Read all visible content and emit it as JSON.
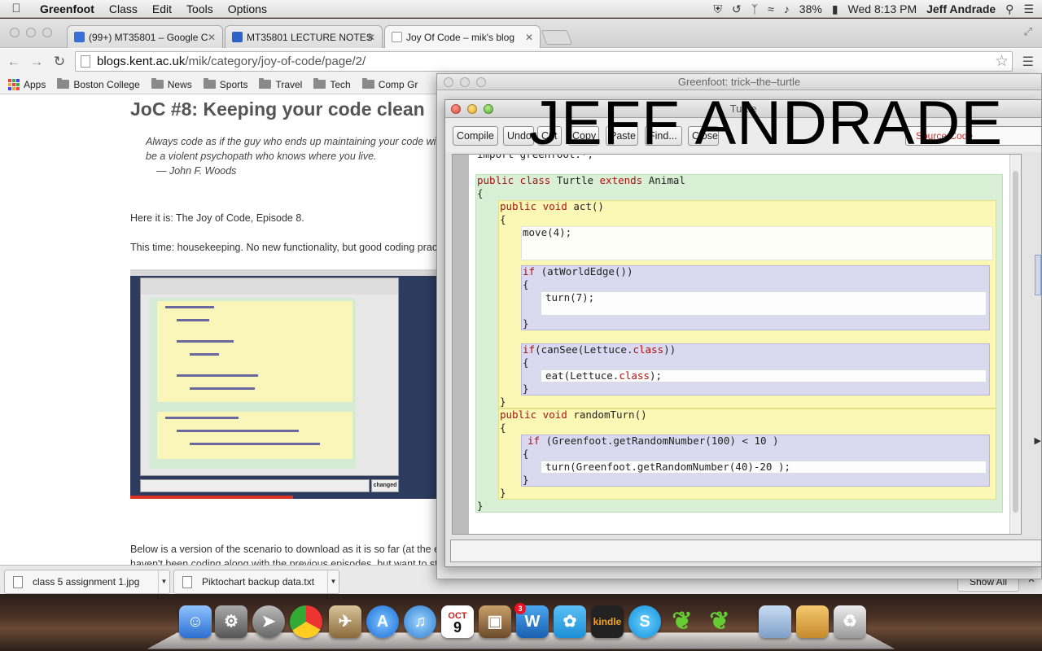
{
  "menubar": {
    "app_name": "Greenfoot",
    "items": [
      "Class",
      "Edit",
      "Tools",
      "Options"
    ],
    "battery": "38%",
    "clock": "Wed 8:13 PM",
    "user": "Jeff Andrade"
  },
  "browser": {
    "tabs": [
      {
        "label": "(99+) MT35801 – Google C",
        "favicon_color": "#3a6fd8"
      },
      {
        "label": "MT35801 LECTURE NOTES",
        "favicon_color": "#2b63c9"
      },
      {
        "label": "Joy Of Code – mik's blog",
        "favicon_color": "#ffffff"
      }
    ],
    "url_domain": "blogs.kent.ac.uk",
    "url_path": "/mik/category/joy-of-code/page/2/",
    "bookmarks": [
      "Apps",
      "Boston College",
      "News",
      "Sports",
      "Travel",
      "Tech",
      "Comp Gr"
    ]
  },
  "blog": {
    "post_title": "JoC #8: Keeping your code clean",
    "quote_line1": "Always code as if the guy who ends up maintaining your code will",
    "quote_line2": "be a violent psychopath who knows where you live.",
    "quote_attribution": "— John F. Woods",
    "para1": "Here it is: The Joy of Code, Episode 8.",
    "para2": "This time: housekeeping. No new functionality, but good coding practi",
    "para3_line1": "Below is a version of the scenario to download as it is so far (at the en",
    "para3_line2": "haven't been coding along with the previous episodes, but want to sta",
    "thumb_status": "changed"
  },
  "downloads": {
    "items": [
      "class 5 assignment 1.jpg",
      "Piktochart backup data.txt"
    ],
    "show_all": "Show All"
  },
  "greenfoot": {
    "main_title": "Greenfoot: trick–the–turtle",
    "editor_title": "Turtle",
    "buttons": [
      "Compile",
      "Undo",
      "Cut",
      "Copy",
      "Paste",
      "Find...",
      "Close"
    ],
    "view_select": "Source Code",
    "code": {
      "import_line": "import greenfoot.*;",
      "class_kw1": "public class",
      "class_name": " Turtle ",
      "class_kw2": "extends",
      "class_super": " Animal",
      "open_brace": "{",
      "close_brace": "}",
      "act_kw": "public void",
      "act_name": " act()",
      "move": "move(4);",
      "if1_kw": "if",
      "if1_cond": " (atWorldEdge())",
      "turn7": "turn(7);",
      "if2_kw": "if",
      "if2_cond_a": "(canSee(Lettuce.",
      "if2_cond_kw": "class",
      "if2_cond_b": "))",
      "eat_a": "eat(Lettuce.",
      "eat_kw": "class",
      "eat_b": ");",
      "rt_kw": "public void",
      "rt_name": " randomTurn()",
      "if3_kw": "if",
      "if3_cond": " (Greenfoot.getRandomNumber(100) < 10 )",
      "turn_random": "turn(Greenfoot.getRandomNumber(40)-20 );"
    }
  },
  "watermark": "JEFF ANDRADE",
  "dock": {
    "badge_count": "3",
    "kindle_label": "kindle",
    "calendar_month": "OCT",
    "calendar_day": "9",
    "word_label": "W"
  }
}
